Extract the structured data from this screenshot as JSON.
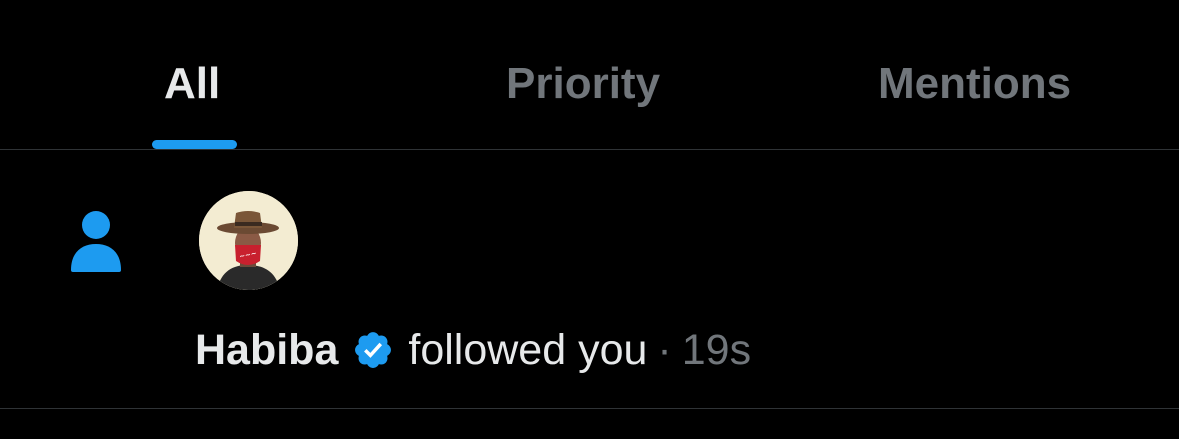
{
  "tabs": [
    {
      "label": "All",
      "active": true
    },
    {
      "label": "Priority",
      "active": false
    },
    {
      "label": "Mentions",
      "active": false
    }
  ],
  "notification": {
    "type_icon": "person-icon",
    "avatar_icon": "user-avatar",
    "user_name": "Habiba",
    "verified_icon": "verified-badge-icon",
    "action": "followed you",
    "separator": "·",
    "time": "19s"
  },
  "colors": {
    "background": "#000000",
    "accent": "#1d9bf0",
    "text_primary": "#e7e9ea",
    "text_secondary": "#71767b",
    "divider": "#2f3336"
  }
}
